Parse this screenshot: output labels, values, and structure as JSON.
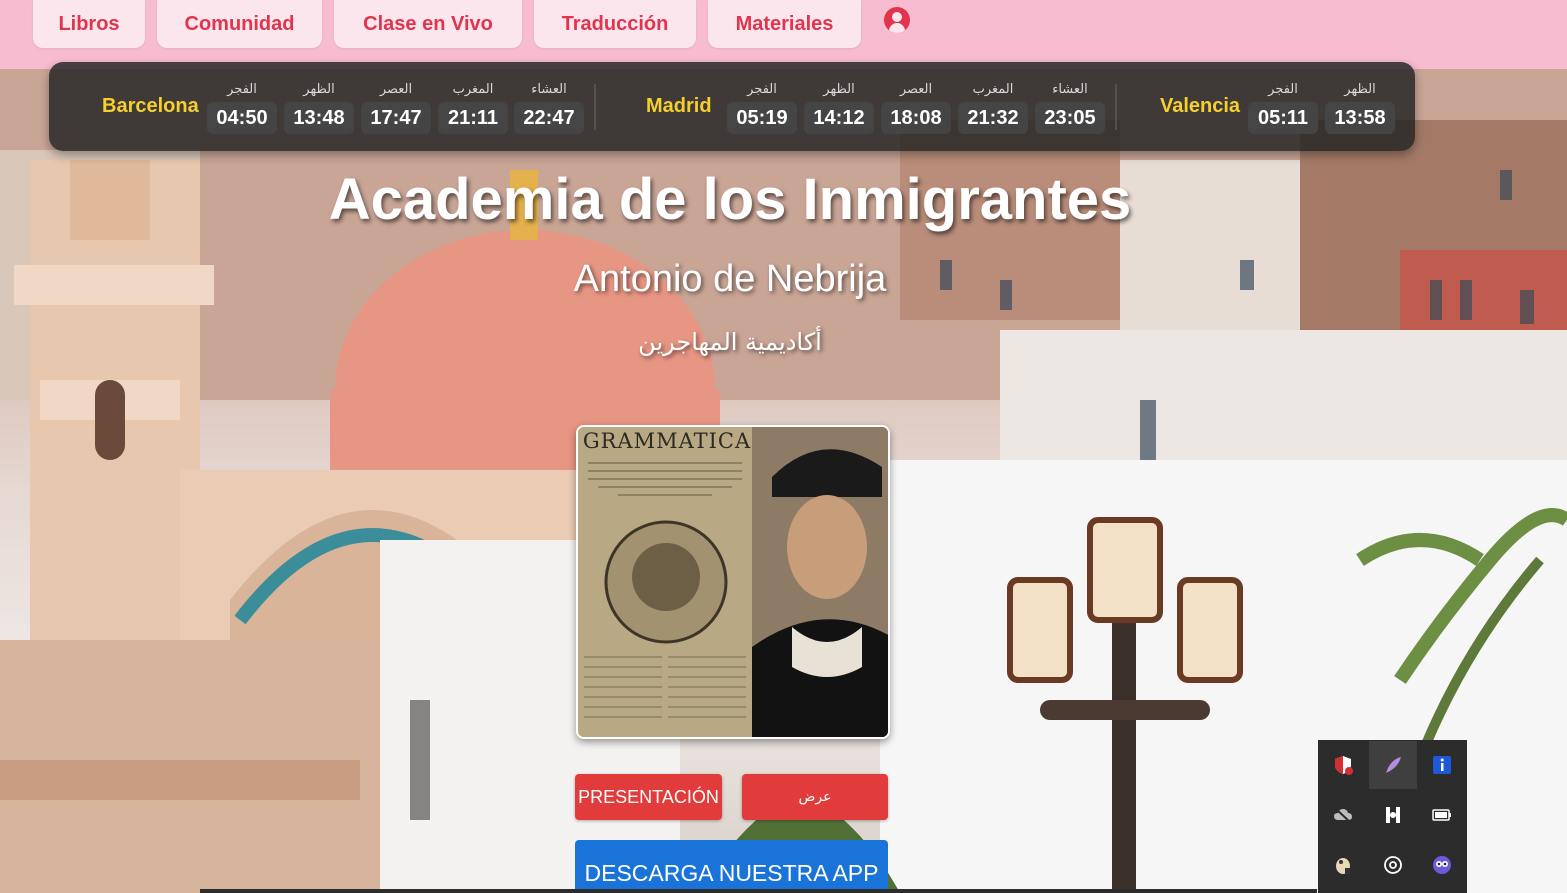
{
  "nav": {
    "items": [
      {
        "label": "Libros"
      },
      {
        "label": "Comunidad"
      },
      {
        "label": "Clase en Vivo"
      },
      {
        "label": "Traducción"
      },
      {
        "label": "Materiales"
      }
    ],
    "user_icon": "user-circle-icon",
    "accent": "#e0354c",
    "background": "#f7bcd0"
  },
  "prayer_times": {
    "cities": [
      {
        "name": "Barcelona",
        "times": [
          {
            "label": "الفجر",
            "time": "04:50"
          },
          {
            "label": "الظهر",
            "time": "13:48"
          },
          {
            "label": "العصر",
            "time": "17:47"
          },
          {
            "label": "المغرب",
            "time": "21:11"
          },
          {
            "label": "العشاء",
            "time": "22:47"
          }
        ]
      },
      {
        "name": "Madrid",
        "times": [
          {
            "label": "الفجر",
            "time": "05:19"
          },
          {
            "label": "الظهر",
            "time": "14:12"
          },
          {
            "label": "العصر",
            "time": "18:08"
          },
          {
            "label": "المغرب",
            "time": "21:32"
          },
          {
            "label": "العشاء",
            "time": "23:05"
          }
        ]
      },
      {
        "name": "Valencia",
        "times": [
          {
            "label": "الفجر",
            "time": "05:11"
          },
          {
            "label": "الظهر",
            "time": "13:58"
          }
        ]
      }
    ],
    "city_color": "#f5cf2e"
  },
  "hero": {
    "title": "Academia de los Inmigrantes",
    "subtitle": "Antonio de Nebrija",
    "arabic_title": "أكاديمية المهاجرين",
    "book_title": "GRAMMATICA"
  },
  "actions": {
    "presentation_label": "PRESENTACIÓN",
    "presentation_ar_label": "عرض",
    "download_label": "DESCARGA NUESTRA APP",
    "red": "#e23b3b",
    "blue": "#1a73d9"
  },
  "tray": {
    "icons": [
      "shield-icon",
      "feather-icon",
      "info-icon",
      "cloud-off-icon",
      "media-icon",
      "battery-icon",
      "paint-icon",
      "openai-icon",
      "owl-icon"
    ]
  }
}
